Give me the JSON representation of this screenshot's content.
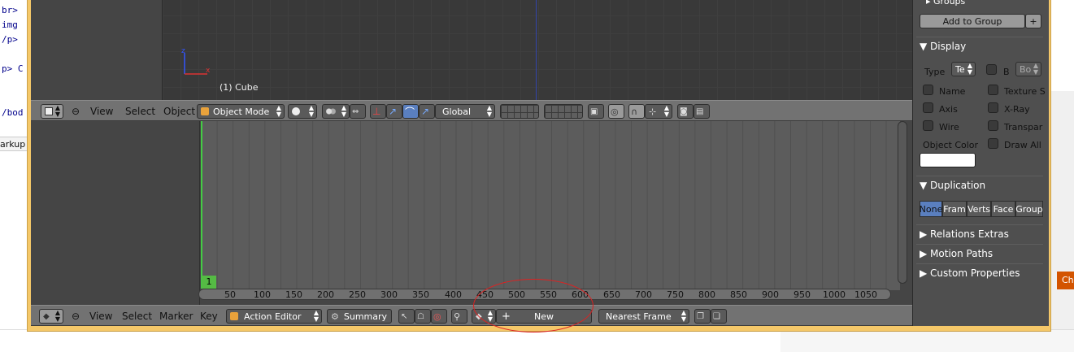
{
  "background": {
    "code_lines": [
      "br>",
      "img",
      "/p>",
      "p> C",
      "/bod"
    ],
    "tab_label": "arkup",
    "right_button": "Ch"
  },
  "viewport": {
    "axis_z": "z",
    "axis_x": "x",
    "object_label": "(1) Cube"
  },
  "viewport_header": {
    "menus": [
      "View",
      "Select",
      "Object"
    ],
    "mode": "Object Mode",
    "orientation": "Global"
  },
  "dopesheet": {
    "current_frame": "1",
    "ticks": [
      "50",
      "100",
      "150",
      "200",
      "250",
      "300",
      "350",
      "400",
      "450",
      "500",
      "550",
      "600",
      "650",
      "700",
      "750",
      "800",
      "850",
      "900",
      "950",
      "1000",
      "1050"
    ]
  },
  "dopesheet_header": {
    "menus": [
      "View",
      "Select",
      "Marker",
      "Key"
    ],
    "editor_mode": "Action Editor",
    "summary": "Summary",
    "new_button": "New",
    "snap_mode": "Nearest Frame"
  },
  "properties": {
    "groups_label": "Groups",
    "add_to_group": "Add to Group",
    "display_title": "Display",
    "type_label": "Type",
    "type_value": "Te",
    "bounds_label": "B",
    "bounds_value": "Bo",
    "name": "Name",
    "texture_space": "Texture S",
    "axis": "Axis",
    "xray": "X-Ray",
    "wire": "Wire",
    "transparency": "Transpar",
    "object_color": "Object Color",
    "draw_all": "Draw All",
    "duplication_title": "Duplication",
    "dup_options": [
      "None",
      "Fram",
      "Verts",
      "Face",
      "Group"
    ],
    "relations_extras": "Relations Extras",
    "motion_paths": "Motion Paths",
    "custom_properties": "Custom Properties"
  },
  "colors": {
    "window_border": "#f5c869",
    "playhead": "#44cc44",
    "selected_segment": "#5a7fbf",
    "annotation": "#dd2222"
  }
}
